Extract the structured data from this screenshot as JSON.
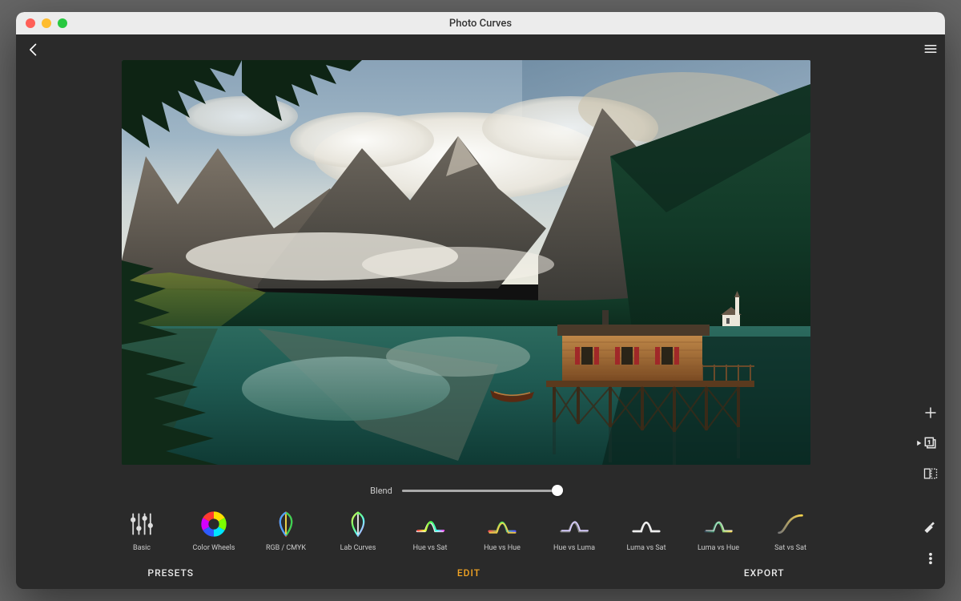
{
  "window": {
    "title": "Photo Curves"
  },
  "blend": {
    "label": "Blend",
    "value": 100
  },
  "tools": [
    {
      "id": "basic",
      "label": "Basic"
    },
    {
      "id": "color-wheels",
      "label": "Color Wheels"
    },
    {
      "id": "rgb-cmyk",
      "label": "RGB / CMYK"
    },
    {
      "id": "lab-curves",
      "label": "Lab Curves"
    },
    {
      "id": "hue-vs-sat",
      "label": "Hue vs Sat"
    },
    {
      "id": "hue-vs-hue",
      "label": "Hue vs Hue"
    },
    {
      "id": "hue-vs-luma",
      "label": "Hue vs Luma"
    },
    {
      "id": "luma-vs-sat",
      "label": "Luma vs Sat"
    },
    {
      "id": "luma-vs-hue",
      "label": "Luma vs Hue"
    },
    {
      "id": "sat-vs-sat",
      "label": "Sat vs Sat"
    }
  ],
  "tabs": {
    "presets": "PRESETS",
    "edit": "EDIT",
    "export": "EXPORT",
    "active": "edit"
  },
  "colors": {
    "accent": "#f5a623"
  }
}
